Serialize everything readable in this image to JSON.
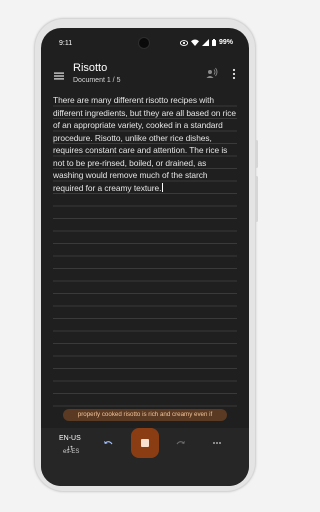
{
  "status_bar": {
    "time": "9:11",
    "battery": "99%",
    "icons": [
      "eye-icon",
      "wifi-icon",
      "signal-icon",
      "battery-icon"
    ]
  },
  "app_bar": {
    "title": "Risotto",
    "subtitle": "Document 1 / 5",
    "icons": [
      "menu-icon",
      "speaker-voice-icon",
      "more-vert-icon"
    ]
  },
  "document": {
    "text": "There are many different risotto recipes with different ingredients, but they are all based on rice of an appropriate variety, cooked in a standard procedure. Risotto, unlike other rice dishes, requires constant care and attention. The rice is not to be pre-rinsed, boiled, or drained, as washing would remove much of the starch required for a creamy texture."
  },
  "caption": {
    "text": "properly cooked risotto is rich and creamy even if"
  },
  "bottom_bar": {
    "primary_language": "EN-US",
    "secondary_language": "es-ES",
    "icons": [
      "swap-icon",
      "undo-icon",
      "stop-icon",
      "redo-icon",
      "more-horiz-icon"
    ]
  },
  "colors": {
    "screen_bg": "#1f1f1f",
    "accent": "#8a3d12",
    "caption_bg": "#5a3a22",
    "caption_text": "#f2c49c"
  }
}
